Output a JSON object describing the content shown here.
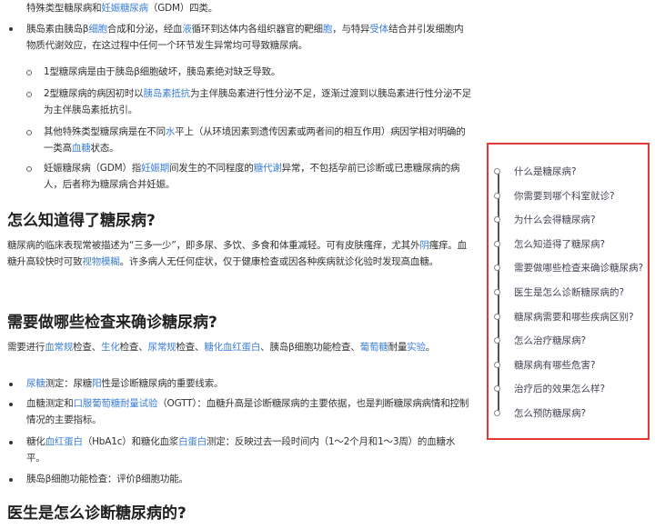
{
  "blocks": [
    {
      "id": "p0",
      "segs": [
        {
          "t": "特殊类型糖尿病和"
        },
        {
          "t": "妊娠糖尿病",
          "l": 1
        },
        {
          "t": "（GDM）四类。"
        }
      ]
    },
    {
      "id": "p1",
      "segs": [
        {
          "t": "胰岛素由胰岛β"
        },
        {
          "t": "细胞",
          "l": 1
        },
        {
          "t": "合成和分泌，经血"
        },
        {
          "t": "液",
          "l": 1
        },
        {
          "t": "循环到达体内各组织器官的靶细"
        },
        {
          "t": "胞",
          "l": 1
        },
        {
          "t": "，与特异"
        },
        {
          "t": "受体",
          "l": 1
        },
        {
          "t": "结合并引发细胞内物质代谢效应，在这过程中任何一个环节发生异常均可导致糖尿病。"
        }
      ]
    },
    {
      "id": "s1",
      "segs": [
        {
          "t": "1型糖尿病是由于胰岛β细胞破坏，胰岛素绝对缺乏导致。"
        }
      ]
    },
    {
      "id": "s2",
      "segs": [
        {
          "t": "2型糖尿病的病因初时以"
        },
        {
          "t": "胰岛素抵抗",
          "l": 1
        },
        {
          "t": "为主伴胰岛素进行性分泌不足，逐渐过渡到以胰岛素进行性分泌不足为主伴胰岛素抵抗引。"
        }
      ]
    },
    {
      "id": "s3",
      "segs": [
        {
          "t": "其他特殊类型糖尿病是在不同"
        },
        {
          "t": "水",
          "l": 1
        },
        {
          "t": "平上（从环境因素到遗传因素或两者间的相互作用）病因学相对明确的一类高"
        },
        {
          "t": "血糖",
          "l": 1
        },
        {
          "t": "状态。"
        }
      ]
    },
    {
      "id": "s4",
      "segs": [
        {
          "t": "妊娠糖尿病（GDM）指"
        },
        {
          "t": "妊娠期",
          "l": 1
        },
        {
          "t": "间发生的不同程度的"
        },
        {
          "t": "糖代谢",
          "l": 1
        },
        {
          "t": "异常，不包括孕前已诊断或已患糖尿病的病人，后者称为糖尿病合并妊娠。"
        }
      ]
    },
    {
      "id": "p2",
      "segs": [
        {
          "t": "糖尿病的临床表现常被描述为“三多一少”，即多尿、多饮、多食和体重减轻。可有皮肤瘙痒，尤其外"
        },
        {
          "t": "阴",
          "l": 1
        },
        {
          "t": "瘙痒。血糖升高较快时可致"
        },
        {
          "t": "视物模糊",
          "l": 1
        },
        {
          "t": "。许多病人无任何症状，仅于健康检查或因各种疾病就诊化验时发现高血糖。"
        }
      ]
    },
    {
      "id": "p3",
      "segs": [
        {
          "t": "需要进行"
        },
        {
          "t": "血常规",
          "l": 1
        },
        {
          "t": "检查、"
        },
        {
          "t": "生化",
          "l": 1
        },
        {
          "t": "检查、"
        },
        {
          "t": "尿常规",
          "l": 1
        },
        {
          "t": "检查、"
        },
        {
          "t": "糖化血红蛋白",
          "l": 1
        },
        {
          "t": "、胰岛β细胞功能检查、"
        },
        {
          "t": "葡萄糖",
          "l": 1
        },
        {
          "t": "耐量"
        },
        {
          "t": "实验",
          "l": 1
        },
        {
          "t": "。"
        }
      ]
    },
    {
      "id": "b1",
      "segs": [
        {
          "t": "尿糖",
          "l": 1
        },
        {
          "t": "测定：尿糖"
        },
        {
          "t": "阳",
          "l": 1
        },
        {
          "t": "性是诊断糖尿病的重要线索。"
        }
      ]
    },
    {
      "id": "b2",
      "segs": [
        {
          "t": "血糖测定和"
        },
        {
          "t": "口服葡萄糖耐量试验",
          "l": 1
        },
        {
          "t": "（OGTT）：血糖升高是诊断糖尿病的主要依据，也是判断糖尿病病情和控制情况的主要指标。"
        }
      ]
    },
    {
      "id": "b3",
      "segs": [
        {
          "t": "糖化"
        },
        {
          "t": "血红蛋白",
          "l": 1
        },
        {
          "t": "（HbA1c）和糖化血浆"
        },
        {
          "t": "白蛋白",
          "l": 1
        },
        {
          "t": "测定：反映过去一段时间内（1～2个月和1～3周）的血糖水平。"
        }
      ]
    },
    {
      "id": "b4",
      "segs": [
        {
          "t": "胰岛β细胞功能检查：评价β细胞功能。"
        }
      ]
    }
  ],
  "headings": [
    "怎么知道得了糖尿病?",
    "需要做哪些检查来确诊糖尿病?",
    "医生是怎么诊断糖尿病的?"
  ],
  "toc": [
    "什么是糖尿病?",
    "你需要到哪个科室就诊?",
    "为什么会得糖尿病?",
    "怎么知道得了糖尿病?",
    "需要做哪些检查来确诊糖尿病?",
    "医生是怎么诊断糖尿病的?",
    "糖尿病需要和哪些疾病区别?",
    "怎么治疗糖尿病?",
    "糖尿病有哪些危害?",
    "治疗后的效果怎么样?",
    "怎么预防糖尿病?"
  ],
  "colors": {
    "link": "#3e7fd6",
    "toc_border": "#e53935"
  }
}
